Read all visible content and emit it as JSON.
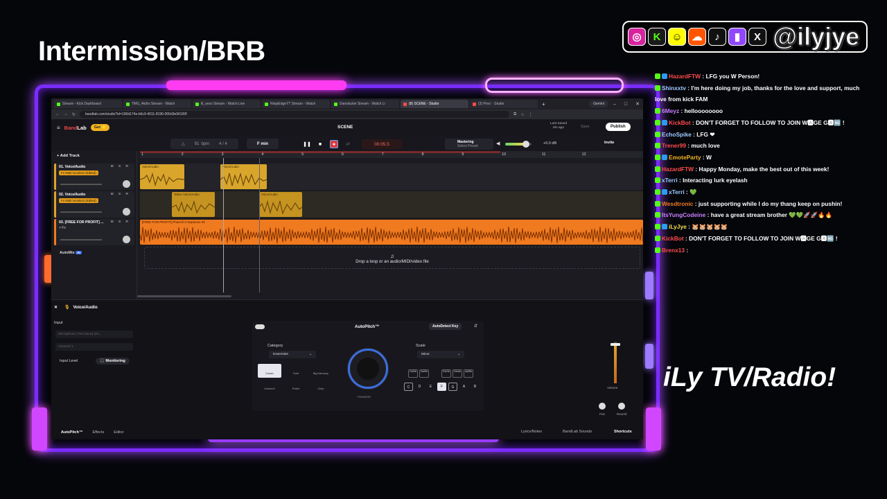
{
  "overlay": {
    "title": "Intermission/BRB",
    "handle": "@ilyjye",
    "tv_label": "iLy TV/Radio!",
    "social_icons": [
      "instagram-icon",
      "kick-icon",
      "snapchat-icon",
      "soundcloud-icon",
      "tiktok-icon",
      "twitch-icon",
      "x-icon"
    ]
  },
  "chat": [
    {
      "user": "HazardFTW",
      "text": "LFG you W Person!",
      "color": "#ff4b4b"
    },
    {
      "user": "Shinxxtv",
      "text": "I'm here doing my job, thanks for the love and support, much love from kick FAM",
      "color": "#9ecbff"
    },
    {
      "user": "6Meyz",
      "text": "helloooooooo",
      "color": "#c880ff"
    },
    {
      "user": "KickBot",
      "text": "DON'T FORGET TO FOLLOW TO JOIN W🅰GE G🅰🆖 !",
      "color": "#ff4b4b"
    },
    {
      "user": "EchoSpike",
      "text": "LFG ❤",
      "color": "#9ecbff"
    },
    {
      "user": "Trener99",
      "text": "much love",
      "color": "#ff4b4b"
    },
    {
      "user": "EmoteParty",
      "text": "W",
      "color": "#f2b51f"
    },
    {
      "user": "HazardFTW",
      "text": "Happy Monday, make the best out of this week!",
      "color": "#ff4b4b"
    },
    {
      "user": "xTerri",
      "text": "Interacting lurk eyelash",
      "color": "#9ecbff"
    },
    {
      "user": "xTerri",
      "text": "💚",
      "color": "#9ecbff"
    },
    {
      "user": "Wesdtronic",
      "text": "just supporting while I do my thang keep on pushin!",
      "color": "#f07a1f"
    },
    {
      "user": "ItsYungCodeine",
      "text": "have a great stream brother 💚💚🚀🚀🔥🔥",
      "color": "#c880ff"
    },
    {
      "user": "iLyJye",
      "text": "🐹🐹🐹🐹🐹",
      "color": "#f2e04a"
    },
    {
      "user": "KickBot",
      "text": "DON'T FORGET TO FOLLOW TO JOIN W🅰GE G🅰🆖 !",
      "color": "#ff4b4b"
    },
    {
      "user": "Brenx13",
      "text": "",
      "color": "#ff4b4b"
    }
  ],
  "browser": {
    "tabs": [
      {
        "label": "Stream - Kick Dashboard",
        "icon": "kick"
      },
      {
        "label": "TMG_4kdro Stream - Watch",
        "icon": "kick"
      },
      {
        "label": "lil_sexo Stream - Watch Live",
        "icon": "kick"
      },
      {
        "label": "NinjaEdgeYT Stream - Watch",
        "icon": "kick"
      },
      {
        "label": "Danslackie Stream - Watch Li",
        "icon": "kick"
      },
      {
        "label": "(8) SCENE - Studio",
        "icon": "red"
      },
      {
        "label": "(3) Pros' - Studio",
        "icon": "red"
      }
    ],
    "new_tab": "+",
    "gemini": "Gemini",
    "url": "bandlab.com/studio?id=190d174e-b6c9-4011-8196-000d3e96100f"
  },
  "studio": {
    "brand_prefix": "Band",
    "brand_suffix": "Lab",
    "get_label": "Get ⭐",
    "scene": "SCENE",
    "last_saved": "Last Saved",
    "last_saved_time": "9m ago",
    "save_label": "Save",
    "publish_label": "Publish",
    "bpm": "91",
    "bpm_unit": "bpm",
    "time_sig": "4 / 4",
    "key": "F min",
    "time": "00:05.5",
    "mastering_title": "Mastering",
    "mastering_sub": "Select Preset",
    "master_db": "+0.0 dB",
    "invite_label": "Invite",
    "add_track": "Add Track",
    "ruler": [
      "1",
      "2",
      "3",
      "4",
      "5",
      "6",
      "7",
      "8",
      "9",
      "10",
      "11",
      "12"
    ],
    "tracks": [
      {
        "name": "01. Voice/Audio",
        "fx": "Fx R&B Vocals22 (Edited)",
        "msr": "M S R"
      },
      {
        "name": "02. Voice/Audio",
        "fx": "Fx R&B Vocals22 (Edited)",
        "msr": "M S R"
      },
      {
        "name": "03. [FREE FOR PROFIT] ...",
        "fx": "+ Fx",
        "msr": "M S R"
      }
    ],
    "clips": {
      "track1": [
        "Voice/Audio",
        "Voice/Audio"
      ],
      "track2": [
        "Takes",
        "Voice/Audio",
        "Voice/Audio"
      ],
      "track3": "[FREE FOR PROFIT] Pharrell X Neptunes 30"
    },
    "automix": "AutoMix",
    "automix_badge": "AI",
    "drop_hint": "Drop a loop or an audio/MIDI/video file"
  },
  "panel": {
    "track_name": "Voice/Audio",
    "input_label": "Input",
    "input_device": "Microphone (Yeti Nano) (04...",
    "channel": "Channel 1",
    "input_level": "Input Level",
    "monitoring": "Monitoring",
    "autopitch_title": "AutoPitch™",
    "autodetect": "AutoDetect Key",
    "category_label": "Category",
    "category_value": "Essentials",
    "styles": [
      "Classic",
      "Duet",
      "Big Harmony",
      "Unsound",
      "Robot",
      "Chirp"
    ],
    "knob_label": "Heaviest",
    "scale_label": "Scale",
    "scale_value": "Minor",
    "sharp_keys": [
      "C#/Db",
      "D#/Eb",
      "",
      "F#/Gb",
      "G#/Ab",
      "A#/Bb"
    ],
    "natural_keys": [
      "C",
      "D",
      "E",
      "F",
      "G",
      "A",
      "B"
    ],
    "volume_label": "Volume",
    "pan_label": "Pan",
    "reverb_label": "Reverb",
    "tabs": [
      "AutoPitch™",
      "Effects",
      "Editor"
    ],
    "right_tabs": [
      "Lyrics/Notes",
      "BandLab Sounds",
      "Shortcuts"
    ]
  }
}
